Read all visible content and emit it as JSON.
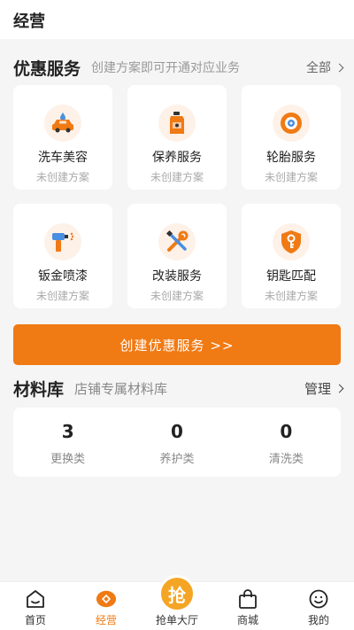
{
  "header": {
    "title": "经营"
  },
  "services": {
    "title": "优惠服务",
    "subtitle": "创建方案即可开通对应业务",
    "more": "全部",
    "items": [
      {
        "name": "洗车美容",
        "status": "未创建方案",
        "icon": "car-wash-icon"
      },
      {
        "name": "保养服务",
        "status": "未创建方案",
        "icon": "oil-can-icon"
      },
      {
        "name": "轮胎服务",
        "status": "未创建方案",
        "icon": "tire-icon"
      },
      {
        "name": "钣金喷漆",
        "status": "未创建方案",
        "icon": "spray-gun-icon"
      },
      {
        "name": "改装服务",
        "status": "未创建方案",
        "icon": "wrench-screwdriver-icon"
      },
      {
        "name": "钥匙匹配",
        "status": "未创建方案",
        "icon": "key-shield-icon"
      }
    ],
    "create_button": "创建优惠服务 >>"
  },
  "materials": {
    "title": "材料库",
    "subtitle": "店铺专属材料库",
    "manage": "管理",
    "stats": [
      {
        "value": "3",
        "label": "更换类"
      },
      {
        "value": "0",
        "label": "养护类"
      },
      {
        "value": "0",
        "label": "清洗类"
      }
    ]
  },
  "tabbar": {
    "items": [
      {
        "label": "首页",
        "icon": "home-icon"
      },
      {
        "label": "经营",
        "icon": "business-icon"
      },
      {
        "label": "抢单大厅",
        "icon": "grab-order-icon",
        "glyph": "抢"
      },
      {
        "label": "商城",
        "icon": "shopping-bag-icon"
      },
      {
        "label": "我的",
        "icon": "profile-icon"
      }
    ],
    "active_index": 1
  },
  "colors": {
    "accent": "#f07a14",
    "icon_bg": "#fdf1e8",
    "blue": "#4a8fe0"
  }
}
